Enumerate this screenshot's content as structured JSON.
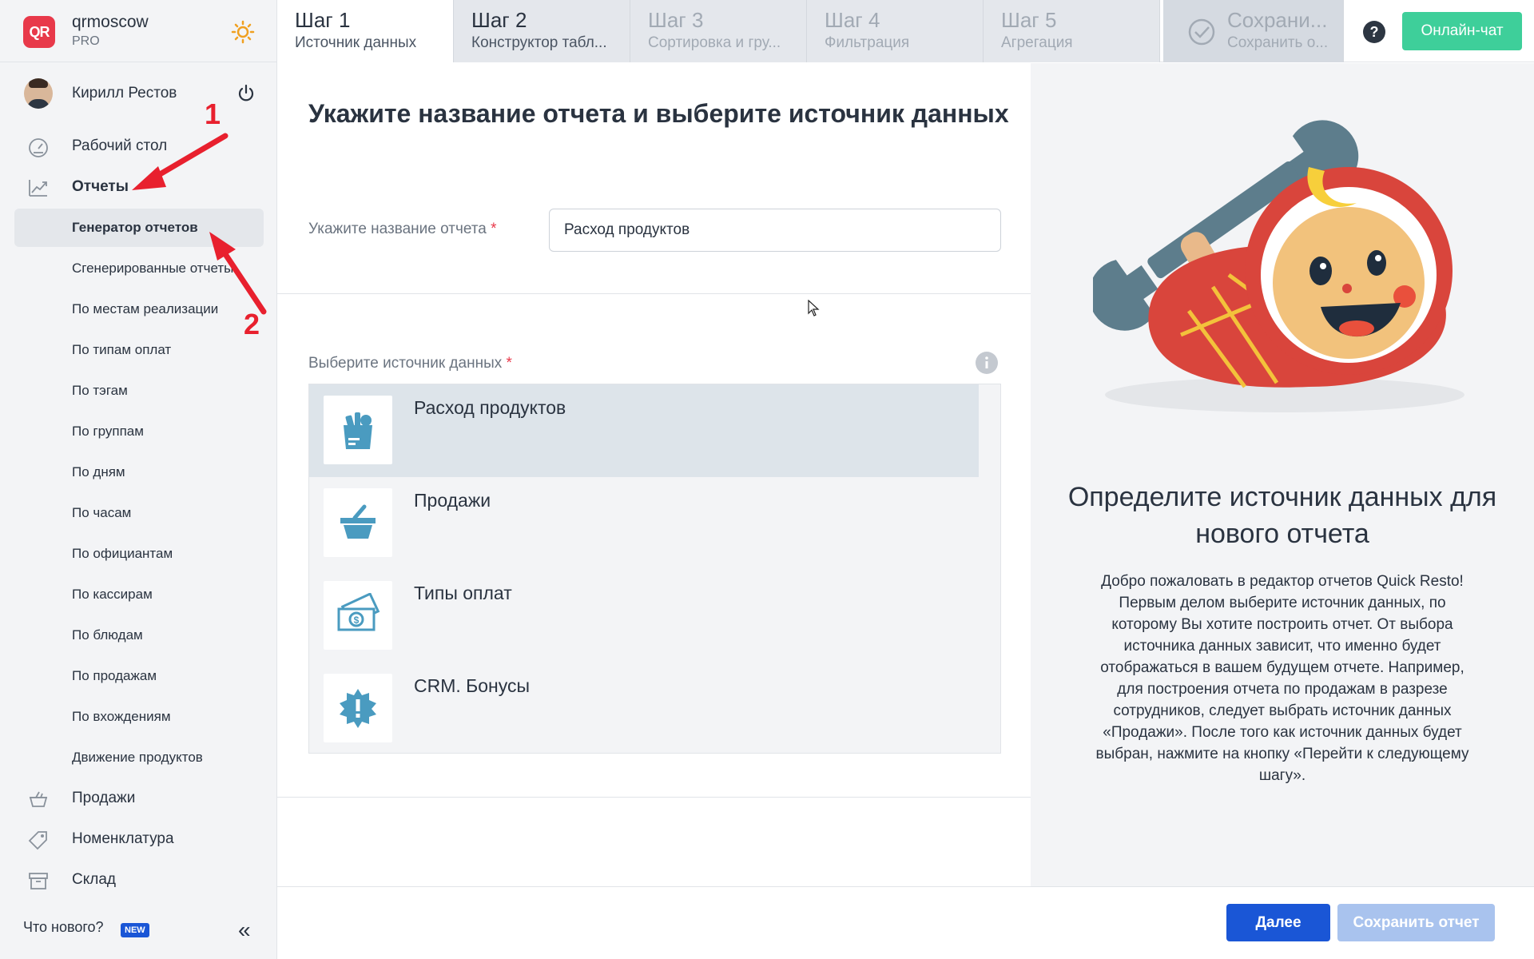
{
  "brand": {
    "logo_text": "QR",
    "name": "qrmoscow",
    "plan": "PRO"
  },
  "user": {
    "name": "Кирилл Рестов"
  },
  "nav": {
    "desktop": "Рабочий стол",
    "reports": "Отчеты",
    "report_items": [
      "Генератор отчетов",
      "Сгенерированные отчеты",
      "По местам реализации",
      "По типам оплат",
      "По тэгам",
      "По группам",
      "По дням",
      "По часам",
      "По официантам",
      "По кассирам",
      "По блюдам",
      "По продажам",
      "По вхождениям",
      "Движение продуктов"
    ],
    "sales": "Продажи",
    "nomenclature": "Номенклатура",
    "warehouse": "Склад"
  },
  "footer_left": {
    "whats_new": "Что нового?",
    "badge": "NEW",
    "collapse": "«"
  },
  "tabs": [
    {
      "step": "Шаг 1",
      "label": "Источник данных"
    },
    {
      "step": "Шаг 2",
      "label": "Конструктор табл..."
    },
    {
      "step": "Шаг 3",
      "label": "Сортировка и гру..."
    },
    {
      "step": "Шаг 4",
      "label": "Фильтрация"
    },
    {
      "step": "Шаг 5",
      "label": "Агрегация"
    },
    {
      "step": "Сохрани...",
      "label": "Сохранить о..."
    }
  ],
  "chat_button": "Онлайн-чат",
  "main": {
    "title": "Укажите название отчета и выберите источник данных",
    "name_label": "Укажите название отчета",
    "name_value": "Расход продуктов",
    "source_label": "Выберите источник данных",
    "required_mark": "*",
    "sources": [
      {
        "name": "Расход продуктов",
        "icon": "grocery-bag-icon"
      },
      {
        "name": "Продажи",
        "icon": "basket-icon"
      },
      {
        "name": "Типы оплат",
        "icon": "cash-icon"
      },
      {
        "name": "CRM. Бонусы",
        "icon": "bonus-badge-icon"
      }
    ]
  },
  "right": {
    "title": "Определите источник данных для нового отчета",
    "text": "Добро пожаловать в редактор отчетов Quick Resto! Первым делом выберите источник данных, по которому Вы хотите построить отчет. От выбора источника данных зависит, что именно будет отображаться в вашем будущем отчете. Например, для построения отчета по продажам в разрезе сотрудников, следует выбрать источник данных «Продажи». После того как источник данных будет выбран, нажмите на кнопку «Перейти к следующему шагу»."
  },
  "footer": {
    "next": "Далее",
    "save": "Сохранить отчет"
  },
  "annotations": {
    "one": "1",
    "two": "2"
  },
  "colors": {
    "accent": "#1a56d6",
    "chat": "#3ecf9a",
    "brand": "#e8394a",
    "arrow": "#e8202e"
  }
}
